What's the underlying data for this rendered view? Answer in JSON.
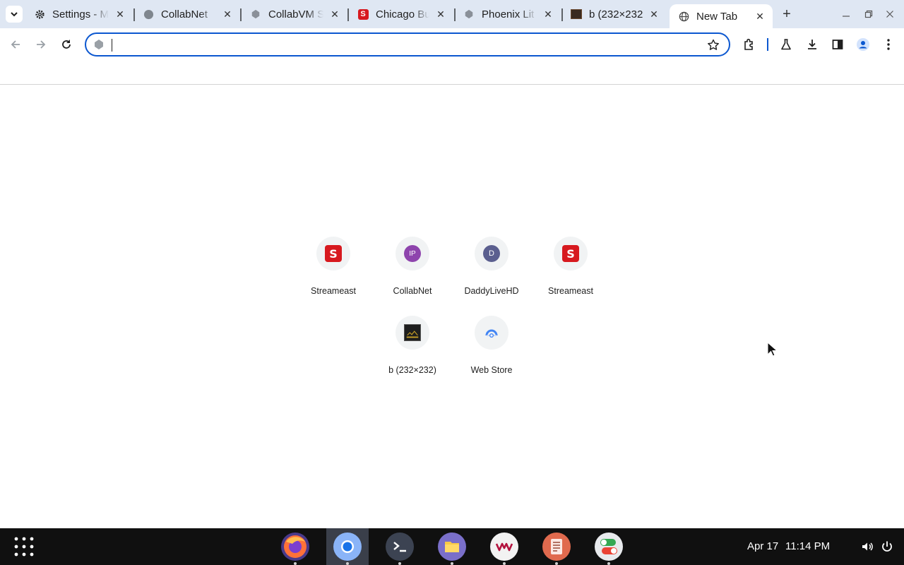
{
  "browser": {
    "tabs": [
      {
        "title": "Settings - Mi",
        "favicon": "gear-icon",
        "active": false
      },
      {
        "title": "CollabNet",
        "favicon": "globe-icon",
        "active": false
      },
      {
        "title": "CollabVM S",
        "favicon": "collabvm-icon",
        "active": false
      },
      {
        "title": "Chicago Bu",
        "favicon": "streameast-s-icon",
        "active": false
      },
      {
        "title": "Phoenix Lit",
        "favicon": "collabvm-icon",
        "active": false
      },
      {
        "title": "b (232×232)",
        "favicon": "image-thumb-icon",
        "active": false
      },
      {
        "title": "New Tab",
        "favicon": "globe-icon",
        "active": true
      }
    ],
    "omnibox": {
      "value": "",
      "placeholder": ""
    },
    "accent_color": "#0b57d0"
  },
  "shortcuts": [
    {
      "label": "Streameast",
      "icon": "streameast-s-icon",
      "glyph": "S"
    },
    {
      "label": "CollabNet",
      "icon": "ip-letter-icon",
      "glyph": "IP",
      "color": "#8e44ad"
    },
    {
      "label": "DaddyLiveHD",
      "icon": "d-letter-icon",
      "glyph": "D",
      "color": "#5b5f8f"
    },
    {
      "label": "Streameast",
      "icon": "streameast-s-icon",
      "glyph": "S"
    },
    {
      "label": "b (232×232)",
      "icon": "image-thumb-icon"
    },
    {
      "label": "Web Store",
      "icon": "web-store-icon"
    }
  ],
  "taskbar": {
    "apps": [
      "firefox-icon",
      "chrome-icon",
      "terminal-icon",
      "files-icon",
      "vm-icon",
      "text-editor-icon",
      "toggle-settings-icon"
    ],
    "date": "Apr 17",
    "time": "11:14 PM"
  }
}
